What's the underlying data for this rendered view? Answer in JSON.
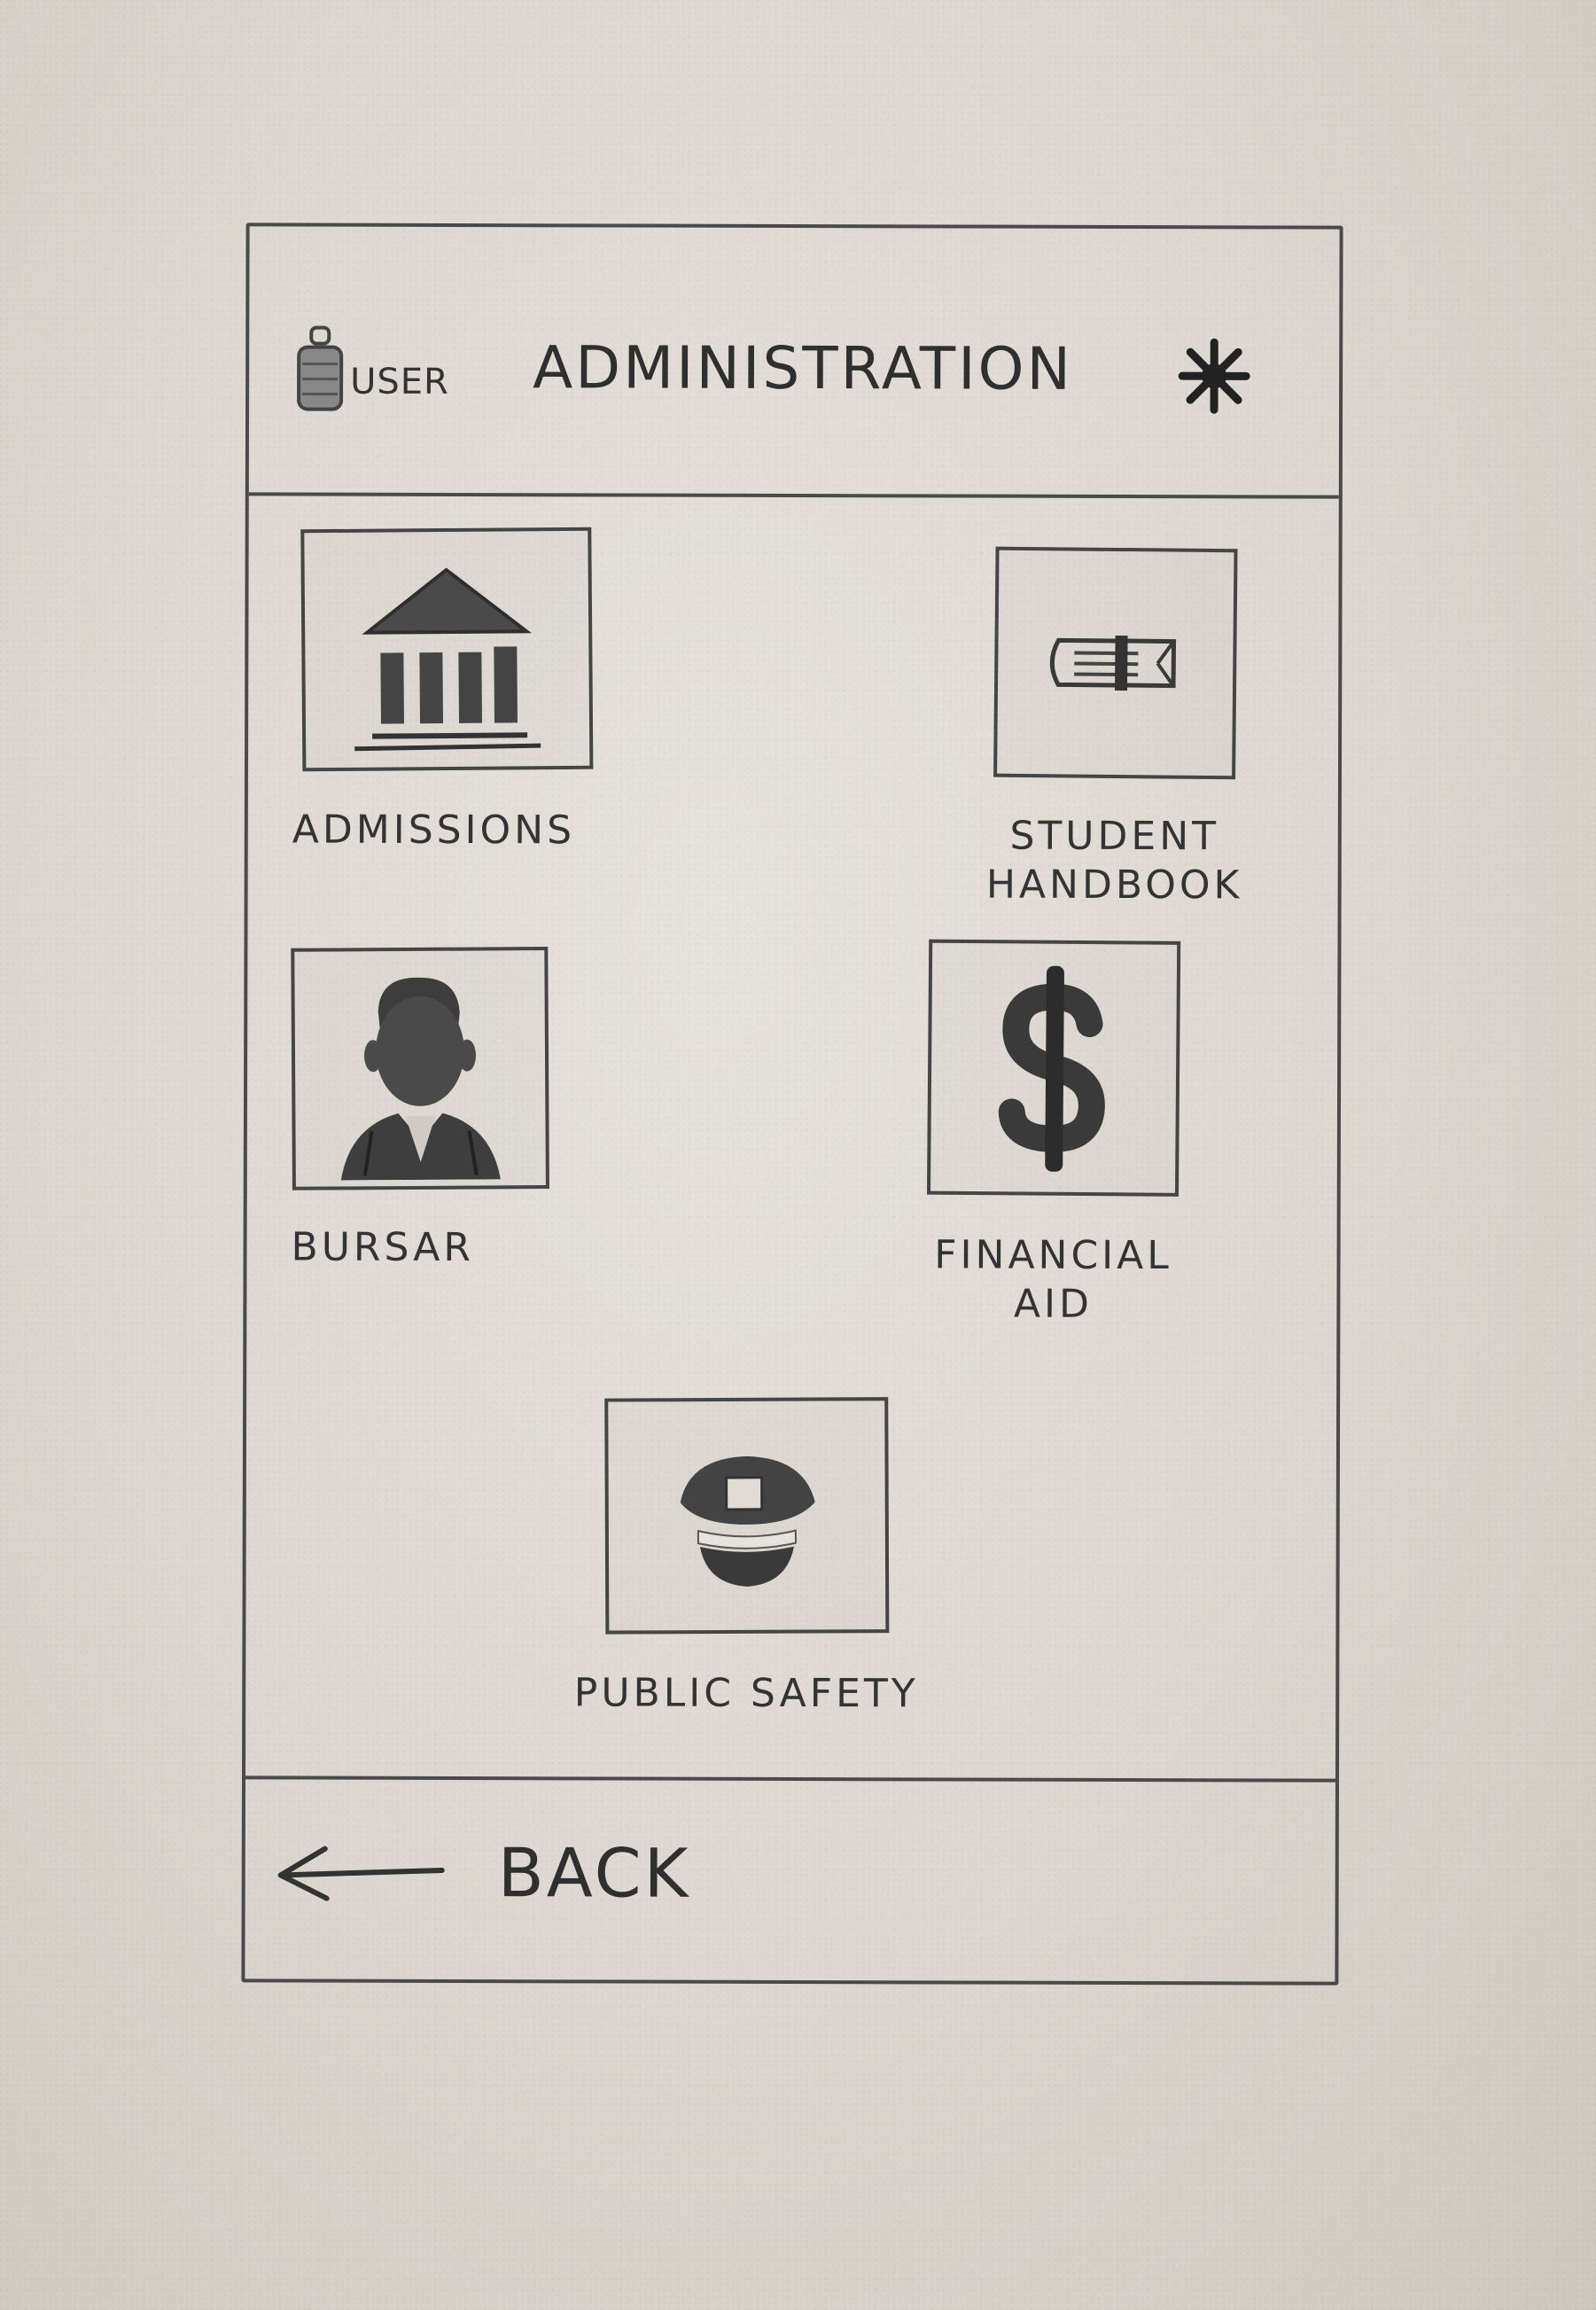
{
  "header": {
    "user_label": "USER",
    "title": "ADMINISTRATION",
    "user_icon": "user-icon",
    "settings_icon": "asterisk-settings-icon"
  },
  "tiles": [
    {
      "label": "ADMISSIONS",
      "icon": "building-columns-icon"
    },
    {
      "label": "STUDENT\nHANDBOOK",
      "icon": "book-icon"
    },
    {
      "label": "BURSAR",
      "icon": "person-portrait-icon"
    },
    {
      "label": "FINANCIAL\nAID",
      "icon": "dollar-sign-icon"
    },
    {
      "label": "PUBLIC SAFETY",
      "icon": "police-hat-icon"
    }
  ],
  "footer": {
    "back_label": "BACK",
    "back_icon": "left-arrow-icon"
  },
  "colors": {
    "paper": "#dcd7d0",
    "pencil": "#3a3a3a"
  }
}
